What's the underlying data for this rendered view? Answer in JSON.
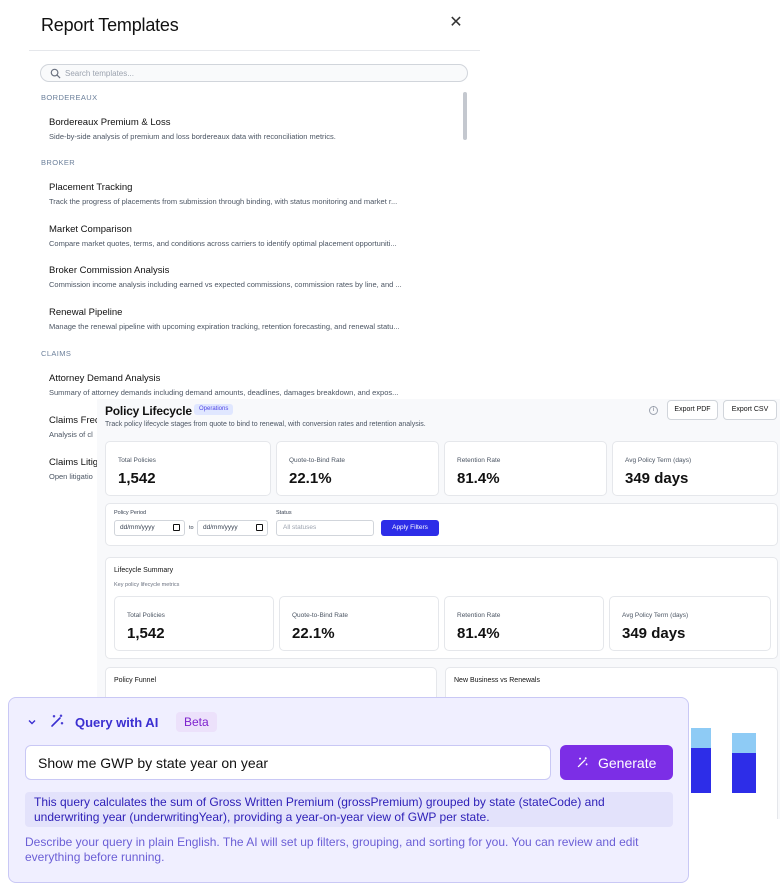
{
  "templates": {
    "title": "Report Templates",
    "search_placeholder": "Search templates...",
    "groups": [
      {
        "label": "BORDEREAUX",
        "items": [
          {
            "name": "Bordereaux Premium & Loss",
            "desc": "Side-by-side analysis of premium and loss bordereaux data with reconciliation metrics."
          }
        ]
      },
      {
        "label": "BROKER",
        "items": [
          {
            "name": "Placement Tracking",
            "desc": "Track the progress of placements from submission through binding, with status monitoring and market r..."
          },
          {
            "name": "Market Comparison",
            "desc": "Compare market quotes, terms, and conditions across carriers to identify optimal placement opportuniti..."
          },
          {
            "name": "Broker Commission Analysis",
            "desc": "Commission income analysis including earned vs expected commissions, commission rates by line, and ..."
          },
          {
            "name": "Renewal Pipeline",
            "desc": "Manage the renewal pipeline with upcoming expiration tracking, retention forecasting, and renewal statu..."
          }
        ]
      },
      {
        "label": "CLAIMS",
        "items": [
          {
            "name": "Attorney Demand Analysis",
            "desc": "Summary of attorney demands including demand amounts, deadlines, damages breakdown, and expos..."
          },
          {
            "name": "Claims Frec",
            "desc": "Analysis of cl"
          },
          {
            "name": "Claims Litig",
            "desc": "Open litigatio"
          }
        ]
      }
    ]
  },
  "dashboard": {
    "title": "Policy Lifecycle",
    "tag": "Operations",
    "subtitle": "Track policy lifecycle stages from quote to bind to renewal, with conversion rates and retention analysis.",
    "export_pdf": "Export PDF",
    "export_csv": "Export CSV",
    "kpis": [
      {
        "label": "Total Policies",
        "value": "1,542"
      },
      {
        "label": "Quote-to-Bind Rate",
        "value": "22.1%"
      },
      {
        "label": "Retention Rate",
        "value": "81.4%"
      },
      {
        "label": "Avg Policy Term (days)",
        "value": "349 days"
      }
    ],
    "filters": {
      "period_label": "Policy Period",
      "date_placeholder": "dd/mm/yyyy",
      "to": "to",
      "status_label": "Status",
      "status_value": "All statuses",
      "apply": "Apply Filters"
    },
    "summary": {
      "title": "Lifecycle Summary",
      "subtitle": "Key policy lifecycle metrics"
    },
    "funnel_title": "Policy Funnel",
    "nb_title": "New Business vs Renewals"
  },
  "ai": {
    "title": "Query with AI",
    "badge": "Beta",
    "query": "Show me GWP by state year on year",
    "generate": "Generate",
    "explanation": "This query calculates the sum of Gross Written Premium (grossPremium) grouped by state (stateCode) and underwriting year (underwritingYear), providing a year-on-year view of GWP per state.",
    "hint": "Describe your query in plain English. The AI will set up filters, grouping, and sorting for you. You can review and edit everything before running."
  },
  "colors": {
    "accent": "#7c2ee6",
    "apply": "#2d2de8",
    "bar_dark": "#2d2de8",
    "bar_light": "#8ecbf5"
  }
}
